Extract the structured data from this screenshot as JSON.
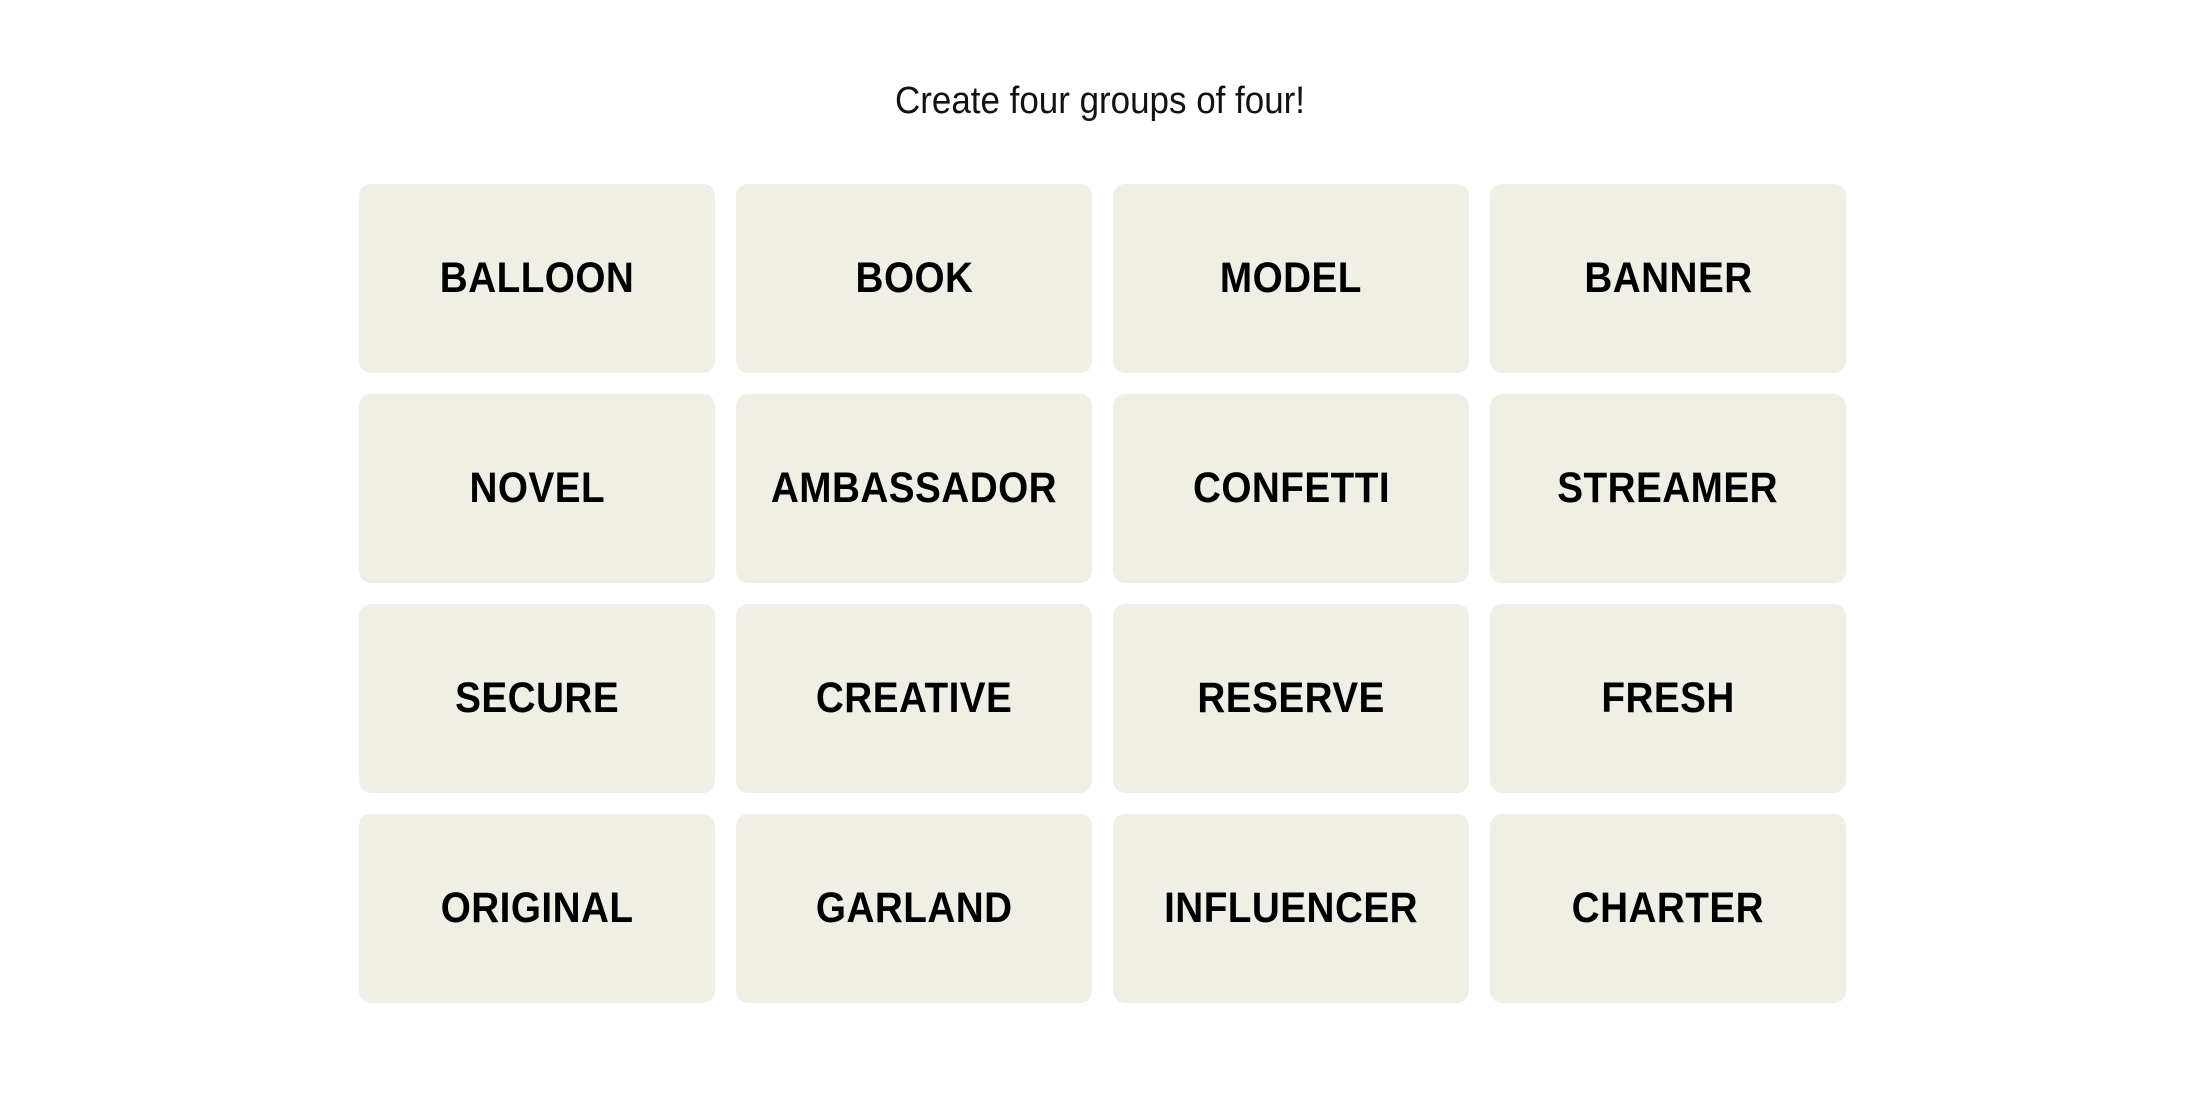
{
  "game": {
    "prompt": "Create four groups of four!",
    "tile_color": "#efefe6",
    "tiles": [
      "BALLOON",
      "BOOK",
      "MODEL",
      "BANNER",
      "NOVEL",
      "AMBASSADOR",
      "CONFETTI",
      "STREAMER",
      "SECURE",
      "CREATIVE",
      "RESERVE",
      "FRESH",
      "ORIGINAL",
      "GARLAND",
      "INFLUENCER",
      "CHARTER"
    ]
  }
}
